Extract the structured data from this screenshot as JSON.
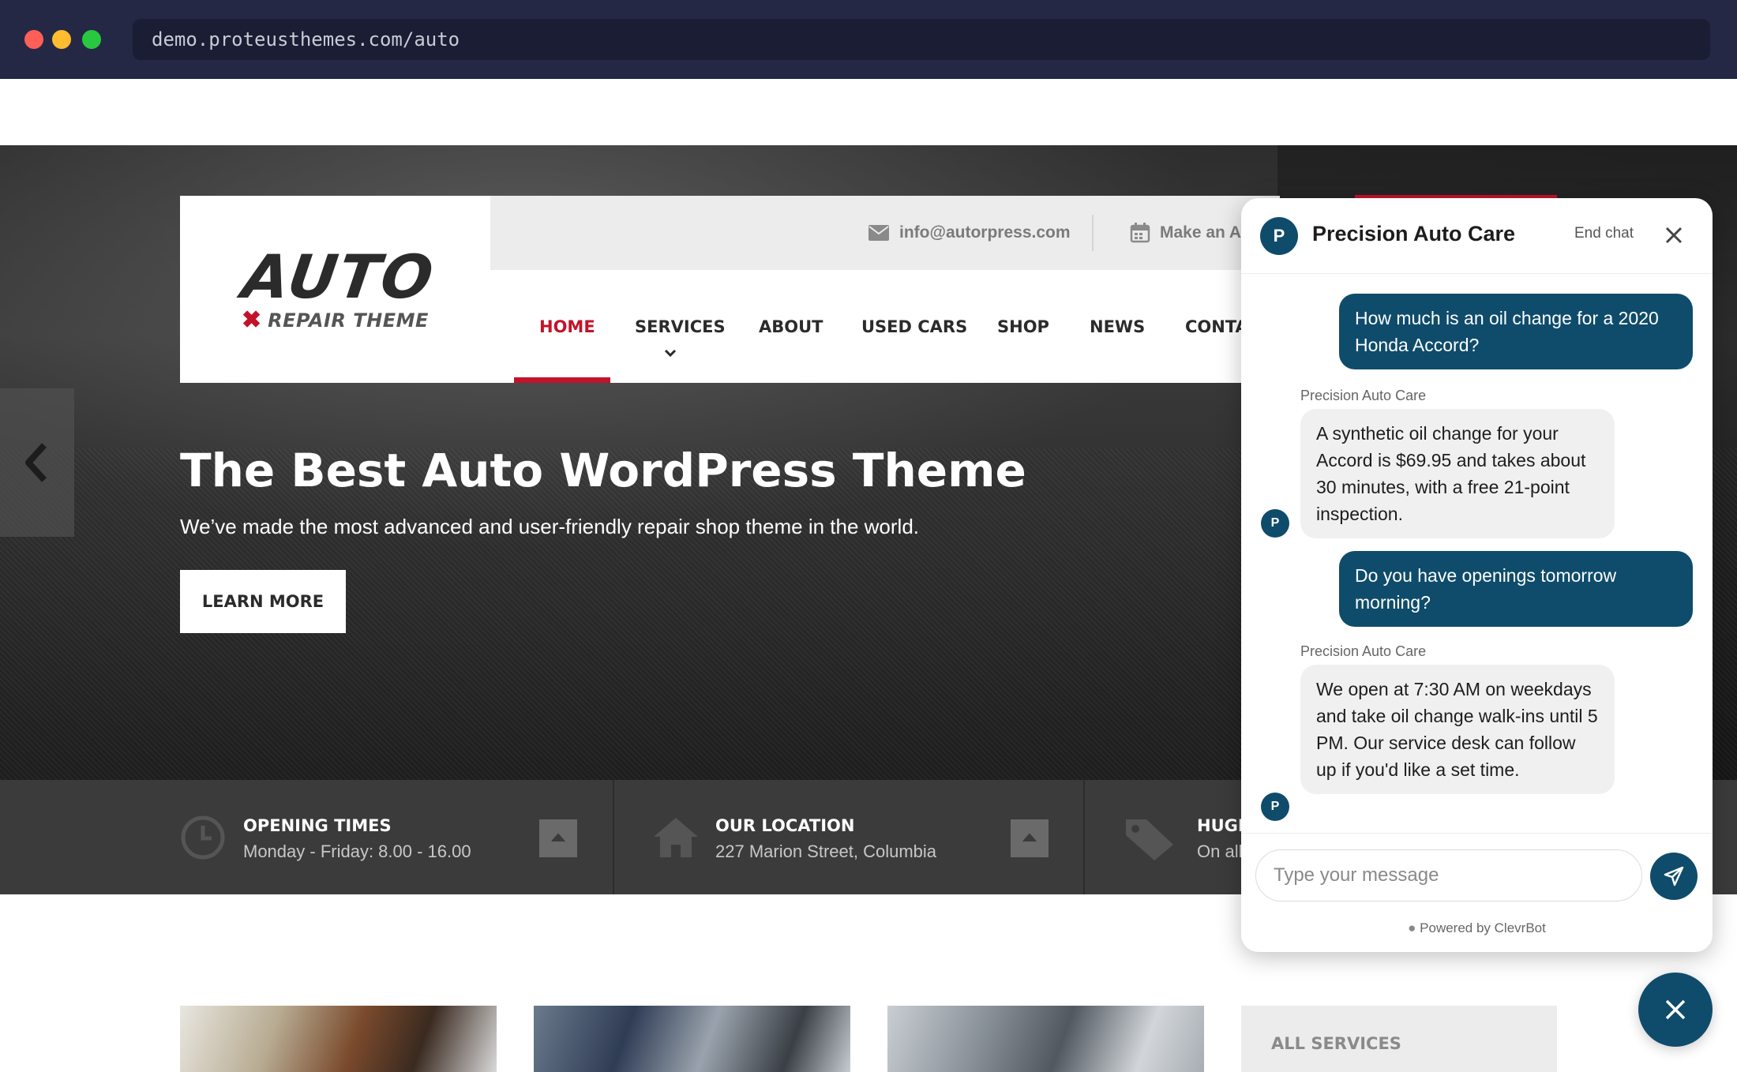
{
  "browser": {
    "url": "demo.proteusthemes.com/auto"
  },
  "site": {
    "logo": {
      "main": "AUTO",
      "sub": "REPAIR THEME"
    },
    "topbar": {
      "email": "info@autorpress.com",
      "appointment": "Make an Ap"
    },
    "nav": [
      {
        "label": "HOME",
        "active": true
      },
      {
        "label": "SERVICES",
        "active": false
      },
      {
        "label": "ABOUT",
        "active": false
      },
      {
        "label": "USED CARS",
        "active": false
      },
      {
        "label": "SHOP",
        "active": false
      },
      {
        "label": "NEWS",
        "active": false
      },
      {
        "label": "CONTA",
        "active": false
      }
    ],
    "hero": {
      "title": "The Best Auto WordPress Theme",
      "subtitle": "We’ve made the most advanced and user-friendly repair shop theme in the world.",
      "button": "LEARN MORE"
    },
    "info": [
      {
        "title": "OPENING TIMES",
        "value": "Monday - Friday: 8.00 - 16.00",
        "icon": "clock-icon"
      },
      {
        "title": "OUR LOCATION",
        "value": "227 Marion Street, Columbia",
        "icon": "home-icon"
      },
      {
        "title": "HUGE",
        "value": "On all",
        "icon": "tag-icon"
      }
    ],
    "all_services": "ALL SERVICES"
  },
  "chat": {
    "avatar_letter": "P",
    "title": "Precision Auto Care",
    "end_chat": "End chat",
    "messages": [
      {
        "from": "user",
        "text": "How much is an oil change for a 2020 Honda Accord?"
      },
      {
        "from": "bot",
        "sender": "Precision Auto Care",
        "text": "A synthetic oil change for your Accord is $69.95 and takes about 30 minutes, with a free 21-point inspection."
      },
      {
        "from": "user",
        "text": "Do you have openings tomorrow morning?"
      },
      {
        "from": "bot",
        "sender": "Precision Auto Care",
        "text": "We open at 7:30 AM on weekdays and take oil change walk-ins until 5 PM. Our service desk can follow up if you'd like a set time."
      }
    ],
    "input_placeholder": "Type your message",
    "powered_by": "Powered by ClevrBot"
  },
  "colors": {
    "brand_red": "#c2132b",
    "chat_primary": "#0f4c6b",
    "chrome_bg": "#242844"
  }
}
